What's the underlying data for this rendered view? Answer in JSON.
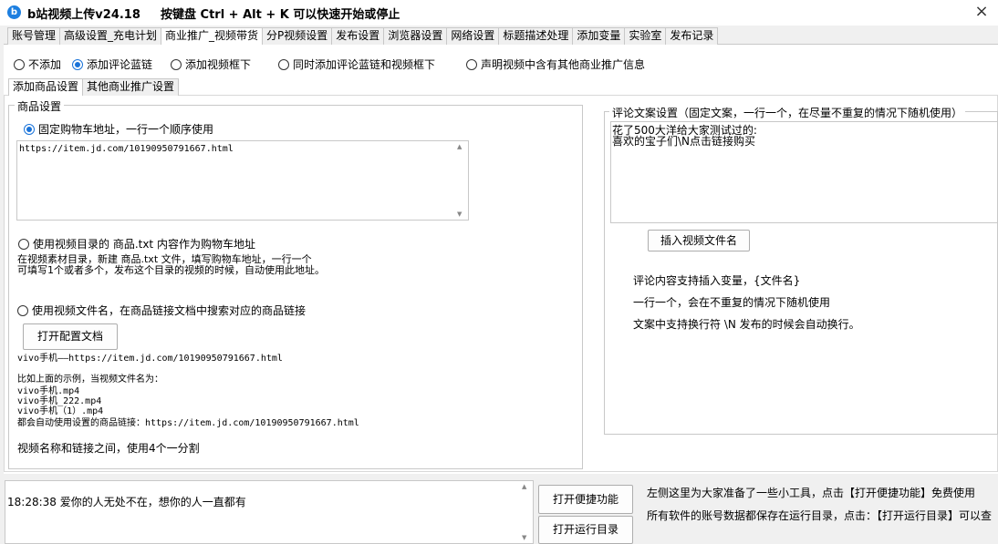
{
  "titlebar": {
    "logo": "b",
    "title": "b站视频上传v24.18",
    "hotkey_hint": "按键盘 Ctrl + Alt + K  可以快速开始或停止",
    "close": "×"
  },
  "main_tabs": [
    "账号管理",
    "高级设置_充电计划",
    "商业推广_视频带货",
    "分P视频设置",
    "发布设置",
    "浏览器设置",
    "网络设置",
    "标题描述处理",
    "添加变量",
    "实验室",
    "发布记录"
  ],
  "promo_mode": {
    "options": [
      "不添加",
      "添加评论蓝链",
      "添加视频框下",
      "同时添加评论蓝链和视频框下",
      "声明视频中含有其他商业推广信息"
    ],
    "selected": 1
  },
  "sub_tabs": [
    "添加商品设置",
    "其他商业推广设置"
  ],
  "product_settings": {
    "group_title": "商品设置",
    "option_fixed_label": "固定购物车地址，一行一个顺序使用",
    "fixed_urls": "https://item.jd.com/10190950791667.html",
    "option_dir_label": "使用视频目录的  商品.txt 内容作为购物车地址",
    "dir_desc_line1": "在视频素材目录，新建 商品.txt  文件，填写购物车地址，一行一个",
    "dir_desc_line2": "可填写1个或者多个，发布这个目录的视频的时候，自动使用此地址。",
    "option_filename_label": "使用视频文件名，在商品链接文档中搜索对应的商品链接",
    "open_config_button": "打开配置文档",
    "example_mapping": "vivo手机——https://item.jd.com/10190950791667.html",
    "example_intro": "比如上面的示例，当视频文件名为：",
    "example_files": [
      "vivo手机.mp4",
      "vivo手机_222.mp4",
      "vivo手机（1）.mp4"
    ],
    "example_result": "都会自动使用设置的商品链接：https://item.jd.com/10190950791667.html",
    "separator_hint": "视频名称和链接之间，使用4个一分割",
    "selected_option": 0
  },
  "comment_settings": {
    "group_title": "评论文案设置（固定文案，一行一个，在尽量不重复的情况下随机使用）",
    "text_line1": "花了500大洋给大家测试过的:",
    "text_line2": "喜欢的宝子们\\N点击链接购买",
    "insert_button": "插入视频文件名",
    "hint1": "评论内容支持插入变量，{文件名}",
    "hint2": "一行一个，会在不重复的情况下随机使用",
    "hint3": "文案中支持换行符 \\N 发布的时候会自动换行。"
  },
  "log": {
    "entry": "18:28:38 爱你的人无处不在，想你的人一直都有"
  },
  "tools": {
    "quick_button": "打开便捷功能",
    "run_dir_button": "打开运行目录",
    "note1": "左侧这里为大家准备了一些小工具，点击【打开便捷功能】免费使用",
    "note2": "所有软件的账号数据都保存在运行目录，点击：【打开运行目录】可以查"
  }
}
